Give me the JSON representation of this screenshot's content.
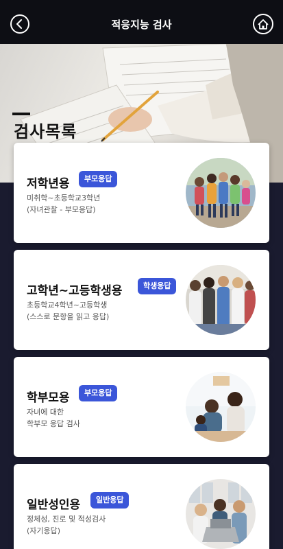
{
  "header": {
    "title": "적응지능 검사",
    "back_icon": "back-arrow-icon",
    "home_icon": "home-icon"
  },
  "hero": {
    "title": "검사목록"
  },
  "cards": [
    {
      "title": "저학년용",
      "badge": "부모응답",
      "desc_line1": "미취학~초등학교3학년",
      "desc_line2": "(자녀관찰 - 부모응답)"
    },
    {
      "title": "고학년~고등학생용",
      "badge": "학생응답",
      "desc_line1": "초등학교4학년~고등학생",
      "desc_line2": "(스스로 문항을 읽고 응답)"
    },
    {
      "title": "학부모용",
      "badge": "부모응답",
      "desc_line1": "자녀에 대한",
      "desc_line2": "학부모 응답 검사"
    },
    {
      "title": "일반성인용",
      "badge": "일반응답",
      "desc_line1": "정체성, 진로 및 적성검사",
      "desc_line2": "(자기응답)"
    }
  ],
  "colors": {
    "accent": "#3b56d9",
    "header_bg": "#0d0e14",
    "page_bg": "#1a1b2f"
  }
}
